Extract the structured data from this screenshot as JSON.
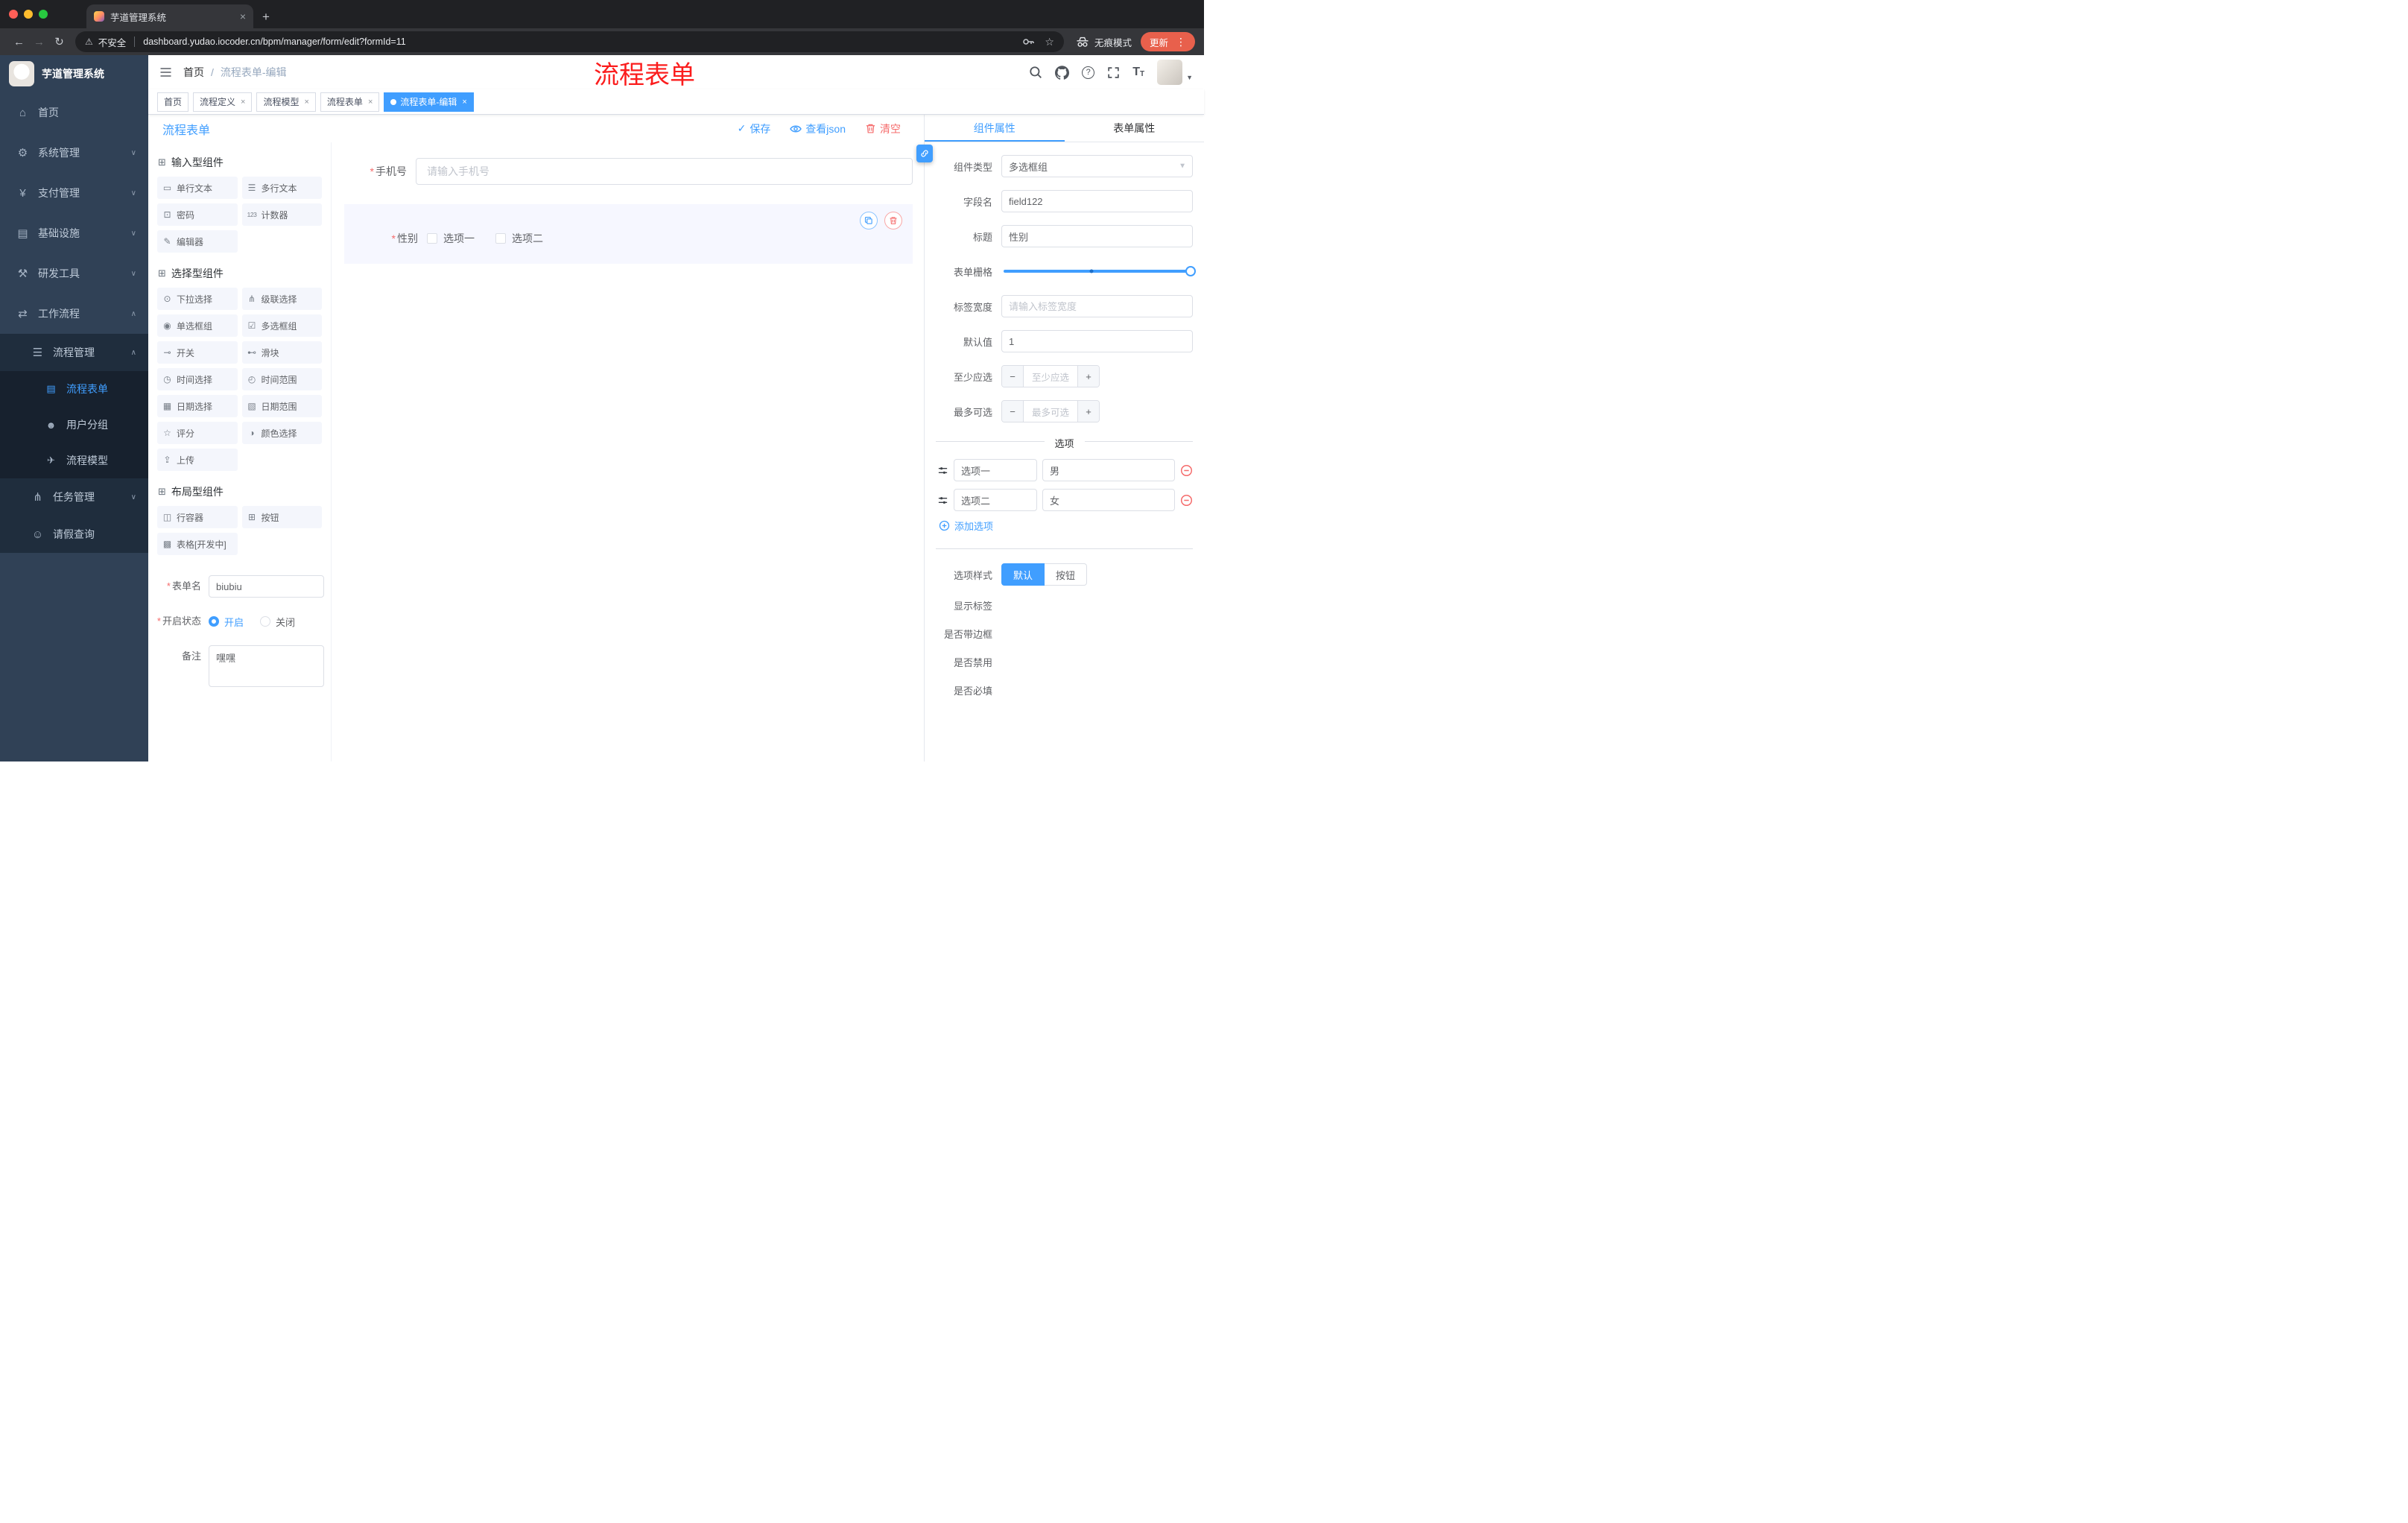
{
  "browser": {
    "tab_title": "芋道管理系统",
    "security_label": "不安全",
    "url": "dashboard.yudao.iocoder.cn/bpm/manager/form/edit?formId=11",
    "incognito_label": "无痕模式",
    "update_label": "更新"
  },
  "annotation": {
    "text": "流程表单"
  },
  "sidebar": {
    "logo_title": "芋道管理系统",
    "menu": [
      {
        "label": "首页",
        "icon": "⌂"
      },
      {
        "label": "系统管理",
        "icon": "⚙"
      },
      {
        "label": "支付管理",
        "icon": "¥"
      },
      {
        "label": "基础设施",
        "icon": "▤"
      },
      {
        "label": "研发工具",
        "icon": "⚒"
      },
      {
        "label": "工作流程",
        "icon": "⇄"
      }
    ],
    "process_mgmt": {
      "label": "流程管理",
      "icon": "☰"
    },
    "process_items": [
      {
        "label": "流程表单",
        "icon": "▤"
      },
      {
        "label": "用户分组",
        "icon": "☻"
      },
      {
        "label": "流程模型",
        "icon": "✈"
      }
    ],
    "task_mgmt": {
      "label": "任务管理",
      "icon": "⋔"
    },
    "leave_query": {
      "label": "请假查询",
      "icon": "☺"
    }
  },
  "navbar": {
    "breadcrumb_home": "首页",
    "breadcrumb_current": "流程表单-编辑"
  },
  "tags": [
    {
      "label": "首页"
    },
    {
      "label": "流程定义"
    },
    {
      "label": "流程模型"
    },
    {
      "label": "流程表单"
    },
    {
      "label": "流程表单-编辑"
    }
  ],
  "designer": {
    "title": "流程表单",
    "save": "保存",
    "view_json": "查看json",
    "clear": "清空"
  },
  "palette": {
    "sections": [
      {
        "title": "输入型组件"
      },
      {
        "title": "选择型组件"
      },
      {
        "title": "布局型组件"
      }
    ],
    "input_items": [
      {
        "label": "单行文本",
        "icon": "▭"
      },
      {
        "label": "多行文本",
        "icon": "☰"
      },
      {
        "label": "密码",
        "icon": "⊡"
      },
      {
        "label": "计数器",
        "icon": "123"
      },
      {
        "label": "编辑器",
        "icon": "✎"
      }
    ],
    "select_items": [
      {
        "label": "下拉选择",
        "icon": "⊙"
      },
      {
        "label": "级联选择",
        "icon": "⋔"
      },
      {
        "label": "单选框组",
        "icon": "◉"
      },
      {
        "label": "多选框组",
        "icon": "☑"
      },
      {
        "label": "开关",
        "icon": "⊸"
      },
      {
        "label": "滑块",
        "icon": "⊷"
      },
      {
        "label": "时间选择",
        "icon": "◷"
      },
      {
        "label": "时间范围",
        "icon": "◴"
      },
      {
        "label": "日期选择",
        "icon": "▦"
      },
      {
        "label": "日期范围",
        "icon": "▧"
      },
      {
        "label": "评分",
        "icon": "☆"
      },
      {
        "label": "颜色选择",
        "icon": "◑"
      },
      {
        "label": "上传",
        "icon": "⇪"
      }
    ],
    "layout_items": [
      {
        "label": "行容器",
        "icon": "◫"
      },
      {
        "label": "按钮",
        "icon": "⊞"
      },
      {
        "label": "表格[开发中]",
        "icon": "▩"
      }
    ]
  },
  "form_config": {
    "name_label": "表单名",
    "name_value": "biubiu",
    "status_label": "开启状态",
    "status_on": "开启",
    "status_off": "关闭",
    "remark_label": "备注",
    "remark_value": "嘿嘿"
  },
  "canvas": {
    "phone": {
      "label": "手机号",
      "placeholder": "请输入手机号"
    },
    "gender": {
      "label": "性别",
      "option1": "选项一",
      "option2": "选项二"
    }
  },
  "props": {
    "tab_component": "组件属性",
    "tab_form": "表单属性",
    "component_type": {
      "label": "组件类型",
      "value": "多选框组"
    },
    "field_name": {
      "label": "字段名",
      "value": "field122"
    },
    "title": {
      "label": "标题",
      "value": "性别"
    },
    "grid": {
      "label": "表单栅格"
    },
    "label_width": {
      "label": "标签宽度",
      "placeholder": "请输入标签宽度"
    },
    "default_value": {
      "label": "默认值",
      "value": "1"
    },
    "min_select": {
      "label": "至少应选",
      "placeholder": "至少应选"
    },
    "max_select": {
      "label": "最多可选",
      "placeholder": "最多可选"
    },
    "options_title": "选项",
    "options": [
      {
        "name": "选项一",
        "value": "男"
      },
      {
        "name": "选项二",
        "value": "女"
      }
    ],
    "add_option": "添加选项",
    "option_style": {
      "label": "选项样式",
      "default": "默认",
      "button": "按钮"
    },
    "show_label": {
      "label": "显示标签",
      "on": true
    },
    "with_border": {
      "label": "是否带边框",
      "on": false
    },
    "disabled": {
      "label": "是否禁用",
      "on": false
    },
    "required": {
      "label": "是否必填",
      "on": true
    }
  },
  "colors": {
    "accent": "#409eff",
    "danger": "#f56c6c",
    "sidebar": "#304156",
    "sidebar_sub": "#1f2d3d",
    "annotation_red": "#fb1d1d",
    "update_pill": "#e8604c"
  }
}
